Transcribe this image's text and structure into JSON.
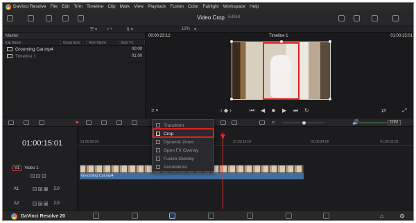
{
  "menubar": {
    "app_name": "DaVinci Resolve",
    "items": [
      "File",
      "Edit",
      "Trim",
      "Timeline",
      "Clip",
      "Mark",
      "View",
      "Playback",
      "Fusion",
      "Color",
      "Fairlight",
      "Workspace",
      "Help"
    ]
  },
  "toolbar": {
    "project_title": "Video Crop",
    "project_status": "Edited",
    "zoom_level": "12%"
  },
  "media_pool": {
    "header": "Master",
    "columns": [
      "Clip Name",
      "Cloud Sync",
      "Reel Name",
      "Start TC"
    ],
    "items": [
      {
        "name": "Grooming Cat.mp4",
        "tc": "00:00"
      },
      {
        "name": "Timeline 1",
        "tc": "01:00"
      }
    ]
  },
  "viewer": {
    "tc_left": "00:00:23:12",
    "timeline_name": "Timeline 1",
    "tc_right": "01:00:15:01"
  },
  "timeline": {
    "timecode": "01:00:15:01",
    "ruler_ticks": [
      "01:00:00:00",
      "01:00:16:00",
      "01:00:24:00",
      "01:00:32:00"
    ],
    "dim_label": "DIM",
    "tracks": [
      {
        "id": "V1",
        "name": "Video 1"
      },
      {
        "id": "A1",
        "level": "2.0"
      },
      {
        "id": "A2",
        "level": "2.0"
      }
    ],
    "audio_clip_name": "Grooming Cat.mp4"
  },
  "inspector_menu": {
    "items": [
      "Transform",
      "Crop",
      "Dynamic Zoom",
      "Open FX Overlay",
      "Fusion Overlay",
      "Annotations"
    ],
    "active": "Crop"
  },
  "bottom": {
    "app_label": "DaVinci Resolve 20"
  },
  "colors": {
    "highlight": "#e02020",
    "audio_clip": "#3d6fa3",
    "playhead": "#e03030"
  }
}
